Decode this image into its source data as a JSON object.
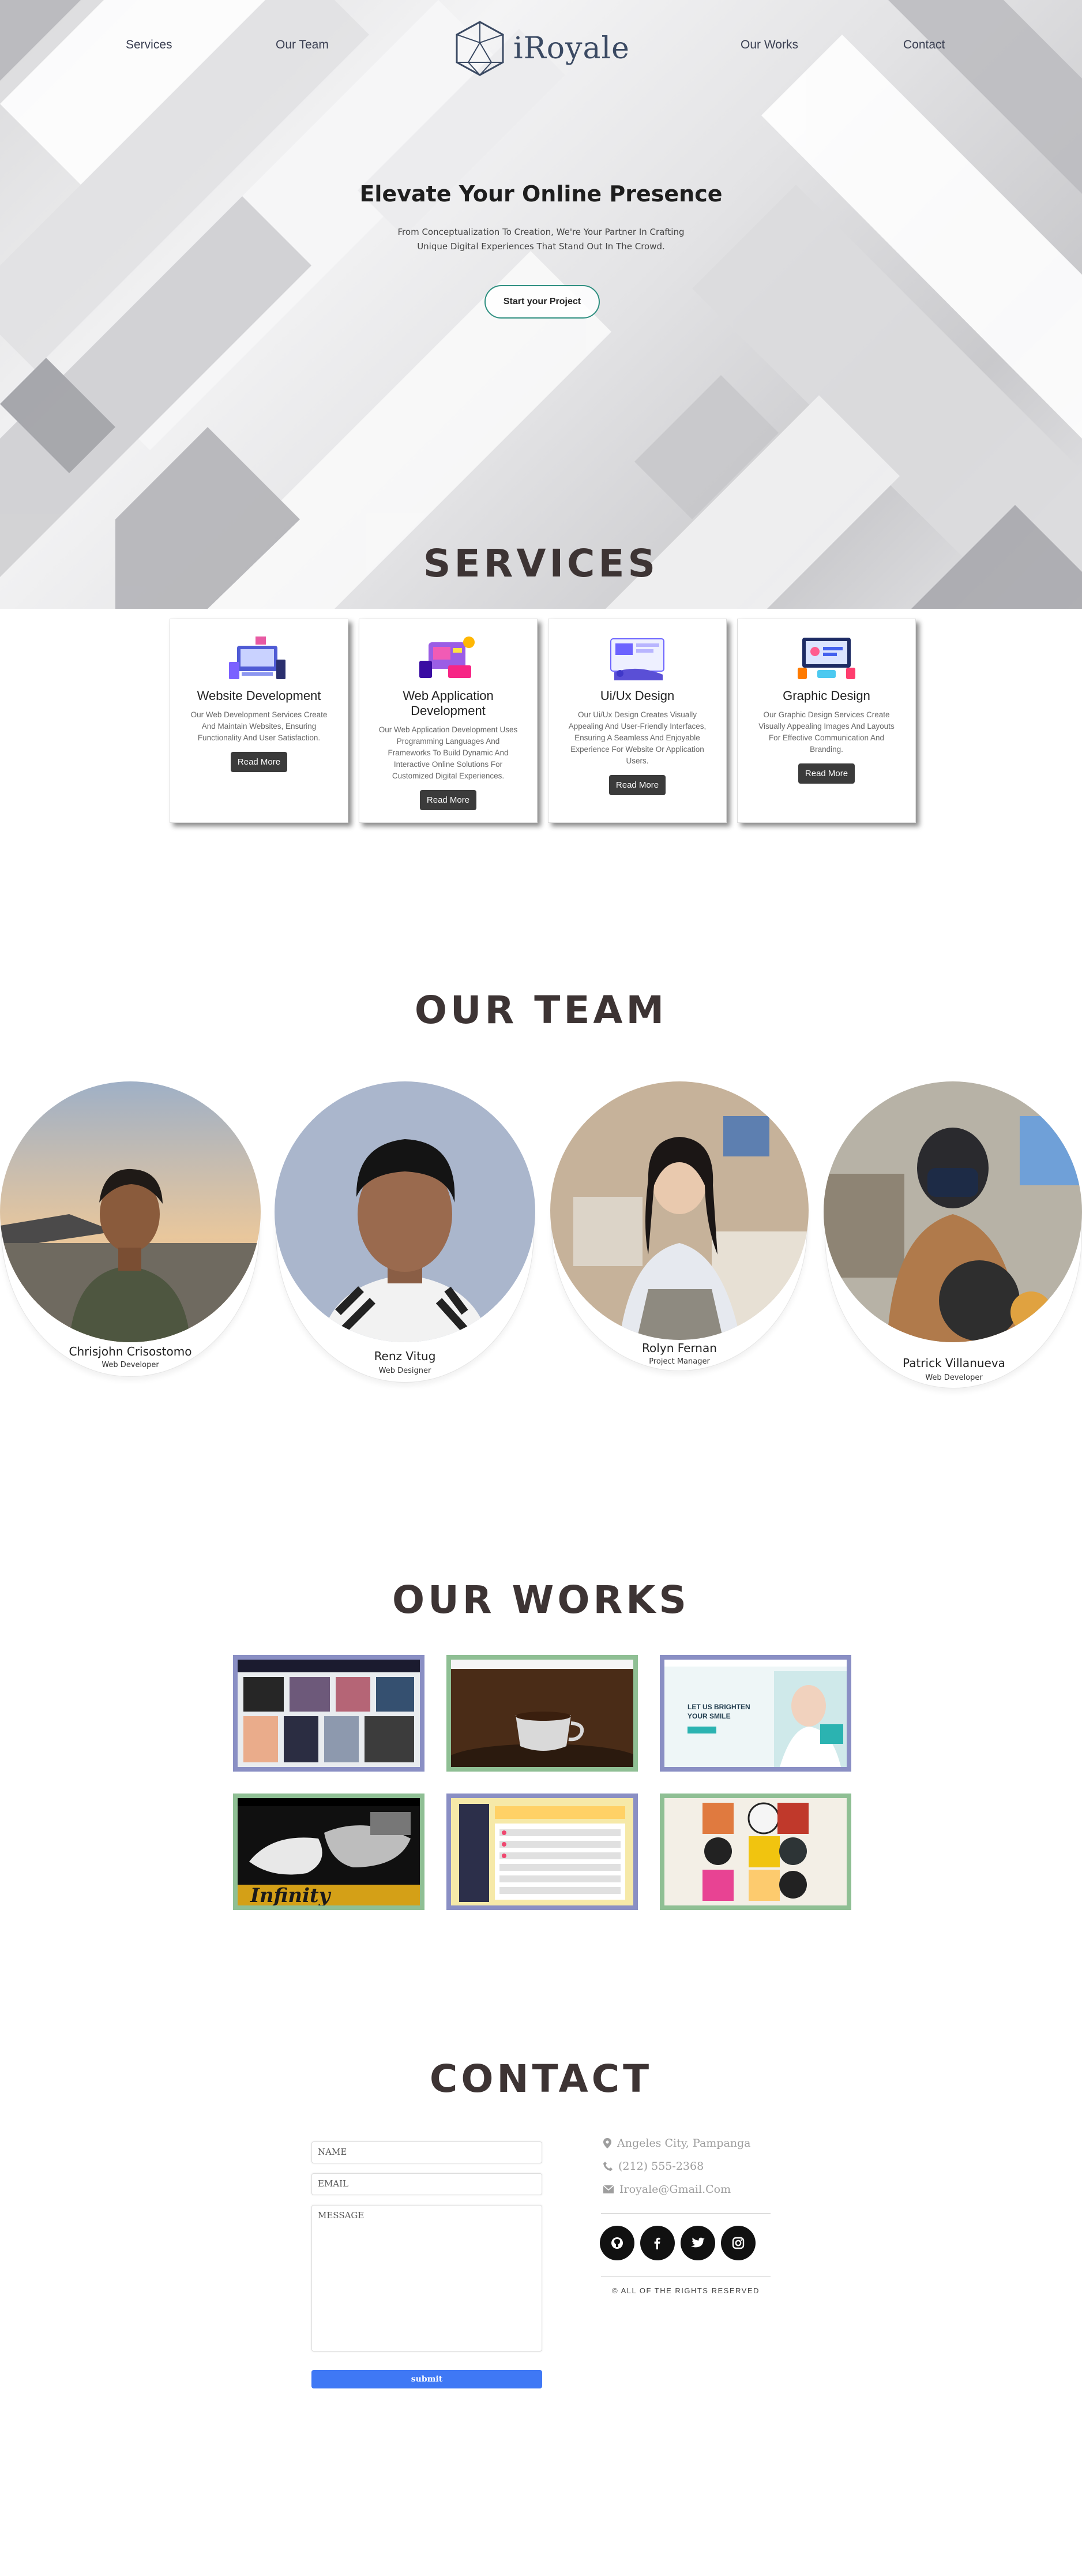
{
  "nav": {
    "services": "Services",
    "our_team": "Our Team",
    "logo_text": "iRoyale",
    "our_works": "Our Works",
    "contact": "Contact"
  },
  "hero": {
    "title": "Elevate Your Online Presence",
    "subtitle": "From Conceptualization To Creation, We're Your Partner In Crafting Unique Digital Experiences That Stand Out In The Crowd.",
    "cta": "Start your Project"
  },
  "services": {
    "heading": "SERVICES",
    "items": [
      {
        "title": "Website Development",
        "description": "Our Web Development Services Create And Maintain Websites, Ensuring Functionality And User Satisfaction.",
        "button": "Read More"
      },
      {
        "title": "Web Application Development",
        "description": "Our Web Application Development Uses Programming Languages And Frameworks To Build Dynamic And Interactive Online Solutions For Customized Digital Experiences.",
        "button": "Read More"
      },
      {
        "title": "Ui/Ux Design",
        "description": "Our Ui/Ux Design Creates Visually Appealing And User-Friendly Interfaces, Ensuring A Seamless And Enjoyable Experience For Website Or Application Users.",
        "button": "Read More"
      },
      {
        "title": "Graphic Design",
        "description": "Our Graphic Design Services Create Visually Appealing Images And Layouts For Effective Communication And Branding.",
        "button": "Read More"
      }
    ]
  },
  "team": {
    "heading": "OUR TEAM",
    "members": [
      {
        "name": "Chrisjohn Crisostomo",
        "role": "Web Developer"
      },
      {
        "name": "Renz Vitug",
        "role": "Web Designer"
      },
      {
        "name": "Rolyn Fernan",
        "role": "Project Manager"
      },
      {
        "name": "Patrick Villanueva",
        "role": "Web Developer"
      }
    ]
  },
  "works": {
    "heading": "OUR WORKS",
    "frame_colors": [
      "#8a8fc4",
      "#8fbf94"
    ],
    "thumb_texts": [
      "LET US BRIGHTEN YOUR SMILE",
      "Infinity"
    ]
  },
  "contact": {
    "heading": "CONTACT",
    "name_placeholder": "NAME",
    "email_placeholder": "EMAIL",
    "message_placeholder": "MESSAGE",
    "submit": "submit",
    "address": "Angeles City, Pampanga",
    "phone": "(212) 555-2368",
    "email": "Iroyale@Gmail.Com",
    "socials": [
      "github-icon",
      "facebook-icon",
      "twitter-icon",
      "instagram-icon"
    ],
    "rights": "© ALL OF THE RIGHTS RESERVED"
  }
}
